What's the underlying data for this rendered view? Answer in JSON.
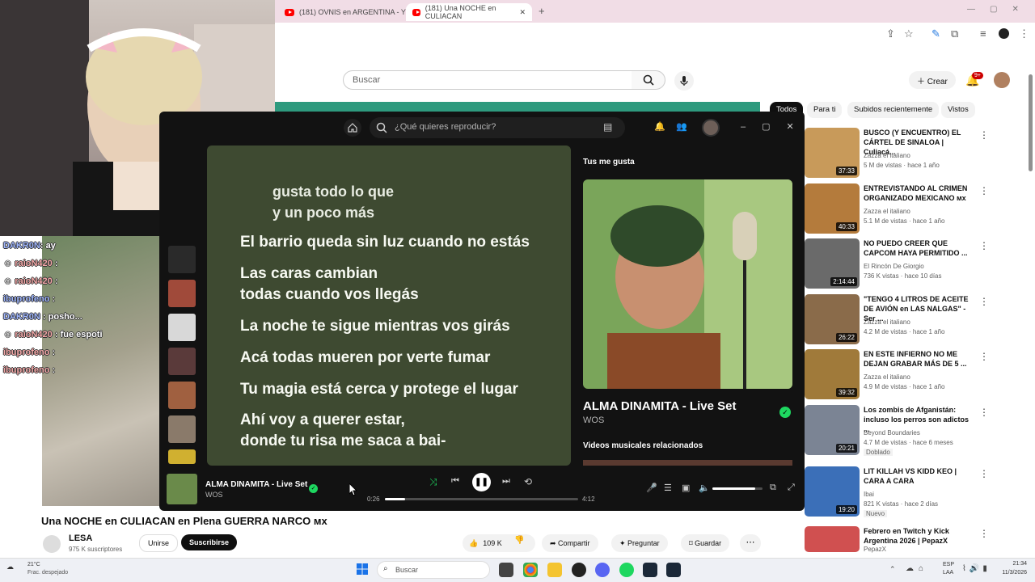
{
  "browser": {
    "tabs": [
      {
        "label": "(181) OVNIS en ARGENTINA - Y"
      },
      {
        "label": "(181) Una NOCHE en CULIACAN"
      }
    ],
    "new_tab": "+"
  },
  "youtube": {
    "search_placeholder": "Buscar",
    "create_label": "Crear",
    "notif_count": "9+",
    "chips": [
      "Todos",
      "Para ti",
      "Subidos recientemente",
      "Vistos"
    ],
    "video_title": "Una NOCHE en CULIACAN en Plena GUERRA NARCO ᴍx",
    "channel": "LESA",
    "subs": "975 K suscriptores",
    "join_label": "Unirse",
    "subscribe_label": "Suscribirse",
    "likes": "109 K",
    "share_label": "Compartir",
    "ask_label": "Preguntar",
    "save_label": "Guardar",
    "related": [
      {
        "title": "BUSCO (Y ENCUENTRO) EL CÁRTEL DE SINALOA | Culiacá...",
        "channel": "Zazza el italiano",
        "meta": "5 M de vistas · hace 1 año",
        "dur": "37:33",
        "color": "#c89a5a"
      },
      {
        "title": "ENTREVISTANDO AL CRIMEN ORGANIZADO MEXICANO ᴍx",
        "channel": "Zazza el italiano",
        "meta": "5.1 M de vistas · hace 1 año",
        "dur": "40:33",
        "color": "#b47b3c"
      },
      {
        "title": "NO PUEDO CREER QUE CAPCOM HAYA PERMITIDO ...",
        "channel": "El Rincón De Giorgio",
        "meta": "736 K vistas · hace 10 días",
        "dur": "2:14:44",
        "color": "#6a6a6a"
      },
      {
        "title": "\"TENGO 4 LITROS DE ACEITE DE AVIÓN en LAS NALGAS\" - Ser ...",
        "channel": "Zazza el italiano",
        "meta": "4.2 M de vistas · hace 1 año",
        "dur": "26:22",
        "color": "#8a6b4a"
      },
      {
        "title": "EN ESTE INFIERNO NO ME DEJAN GRABAR MÁS DE 5 ...",
        "channel": "Zazza el italiano",
        "meta": "4.9 M de vistas · hace 1 año",
        "dur": "39:32",
        "color": "#a07a3a"
      },
      {
        "title": "Los zombis de Afganistán: incluso los perros son adictos ...",
        "channel": "Beyond Boundaries",
        "meta": "4.7 M de vistas · hace 6 meses",
        "dur": "20:21",
        "color": "#7b8494",
        "badge": "Doblado"
      },
      {
        "title": "LIT KILLAH VS KIDD KEO | CARA A CARA",
        "channel": "Ibai",
        "meta": "821 K vistas · hace 2 días",
        "dur": "19:20",
        "color": "#3b6fb8",
        "badge": "Nuevo"
      },
      {
        "title": "Febrero en Twitch y Kick Argentina 2026 | PepazX",
        "channel": "PepazX",
        "meta": "",
        "dur": "",
        "color": "#d05050"
      }
    ]
  },
  "chat": [
    {
      "user": "DAKR0N",
      "msg": ": ay"
    },
    {
      "user": "raioN420",
      "msg": ":"
    },
    {
      "user": "raioN420",
      "msg": ":"
    },
    {
      "user": "ibuprofeno",
      "msg": ":"
    },
    {
      "user": "DAKR0N",
      "msg": ": posho..."
    },
    {
      "user": "raioN420",
      "msg": ": fue espoti"
    },
    {
      "user": "ibuprofeno",
      "msg": ":"
    },
    {
      "user": "ibuprofeno",
      "msg": ":"
    }
  ],
  "spotify": {
    "search_placeholder": "¿Qué quieres reproducir?",
    "lyrics": [
      "gusta todo lo que",
      "y un poco más",
      "El barrio queda sin luz cuando no estás",
      "Las caras cambian",
      "todas cuando vos llegás",
      "La noche te sigue mientras vos girás",
      "Acá todas mueren por verte fumar",
      "Tu magia está cerca y protege el lugar",
      "Ahí voy a querer estar,",
      "donde tu risa me saca a bai-"
    ],
    "panel_header": "Tus me gusta",
    "track_title": "ALMA DINAMITA - Live Set",
    "artist": "WOS",
    "related_videos_label": "Videos musicales relacionados",
    "now_playing_title": "ALMA DINAMITA - Live Set",
    "now_playing_artist": "WOS",
    "elapsed": "0:26",
    "duration": "4:12",
    "progress": 0.103,
    "volume": 0.85
  },
  "taskbar": {
    "weather_temp": "21°C",
    "weather_desc": "Frac. despejado",
    "search_label": "Buscar",
    "lang": "ESP",
    "lang2": "LAA",
    "time": "21:34",
    "date": "11/3/2026"
  }
}
